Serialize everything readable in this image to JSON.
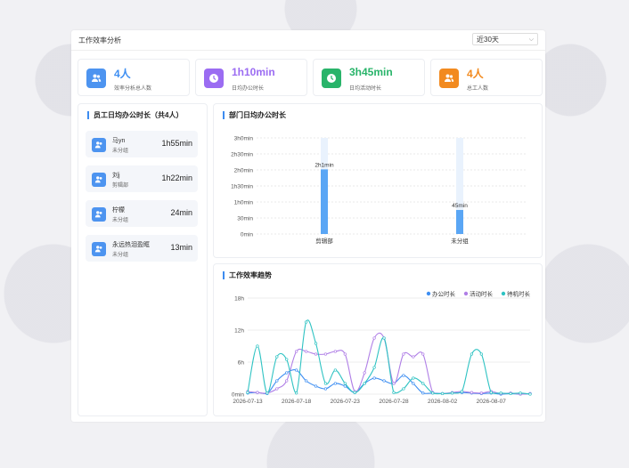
{
  "header": {
    "title": "工作效率分析",
    "range_select": "近30天"
  },
  "stats": [
    {
      "value": "4人",
      "label": "效率分析总人数",
      "color": "#4d94f0",
      "icon": "users-icon"
    },
    {
      "value": "1h10min",
      "label": "日均办公时长",
      "color": "#9b6cf2",
      "icon": "clock-icon"
    },
    {
      "value": "3h45min",
      "label": "日均活动时长",
      "color": "#29b46a",
      "icon": "clock-icon"
    },
    {
      "value": "4人",
      "label": "总工人数",
      "color": "#f28a1f",
      "icon": "users-icon"
    }
  ],
  "employees": {
    "title": "员工日均办公时长（共4人）",
    "items": [
      {
        "name": "马yn",
        "dept": "未分组",
        "time": "1h55min"
      },
      {
        "name": "刘j",
        "dept": "剪辑部",
        "time": "1h22min"
      },
      {
        "name": "柠檬",
        "dept": "未分组",
        "time": "24min"
      },
      {
        "name": "永远热泪盈眶",
        "dept": "未分组",
        "time": "13min"
      }
    ]
  },
  "chart_data": [
    {
      "type": "bar",
      "title": "部门日均办公时长",
      "categories": [
        "剪辑部",
        "未分组"
      ],
      "values": [
        121,
        45
      ],
      "value_labels": [
        "2h1min",
        "45min"
      ],
      "yticks": [
        "0min",
        "30min",
        "1h0min",
        "1h30min",
        "2h0min",
        "2h30min",
        "3h0min"
      ],
      "ylim": [
        0,
        180
      ],
      "grid": true,
      "bar_color": "#5aa6f5",
      "bg_bar_color": "#e9f2fd"
    },
    {
      "type": "line",
      "title": "工作效率趋势",
      "x": [
        "2026-07-13",
        "2026-07-14",
        "2026-07-15",
        "2026-07-16",
        "2026-07-17",
        "2026-07-18",
        "2026-07-19",
        "2026-07-20",
        "2026-07-21",
        "2026-07-22",
        "2026-07-23",
        "2026-07-24",
        "2026-07-25",
        "2026-07-26",
        "2026-07-27",
        "2026-07-28",
        "2026-07-29",
        "2026-07-30",
        "2026-07-31",
        "2026-08-01",
        "2026-08-02",
        "2026-08-03",
        "2026-08-04",
        "2026-08-05",
        "2026-08-06",
        "2026-08-07",
        "2026-08-08",
        "2026-08-09",
        "2026-08-10",
        "2026-08-11"
      ],
      "xticks": [
        "2026-07-13",
        "2026-07-18",
        "2026-07-23",
        "2026-07-28",
        "2026-08-02",
        "2026-08-07"
      ],
      "yticks": [
        "0min",
        "6h",
        "12h",
        "18h"
      ],
      "ylim": [
        0,
        18
      ],
      "legend_position": "top-right",
      "series": [
        {
          "name": "办公时长",
          "color": "#3f8ff2",
          "values": [
            0.2,
            0.3,
            0.1,
            2.5,
            4.0,
            4.5,
            2.5,
            1.5,
            1.0,
            2.0,
            1.5,
            0.3,
            2.0,
            3.0,
            2.5,
            2.0,
            3.5,
            2.0,
            0.2,
            0.2,
            0.1,
            0.2,
            0.3,
            0.2,
            0.1,
            0.2,
            0.0,
            0.1,
            0.0,
            0.1
          ]
        },
        {
          "name": "活动时长",
          "color": "#b07fe6",
          "values": [
            0.5,
            0.3,
            0.2,
            1.0,
            2.5,
            8.0,
            8.0,
            7.5,
            7.5,
            8.0,
            7.5,
            0.5,
            4.0,
            10.5,
            10.5,
            2.0,
            7.5,
            7.0,
            7.5,
            0.3,
            0.1,
            0.3,
            0.5,
            0.3,
            0.2,
            0.5,
            0.1,
            0.2,
            0.0,
            0.1
          ]
        },
        {
          "name": "待机时长",
          "color": "#2fc3c3",
          "values": [
            0.3,
            9.0,
            0.2,
            7.0,
            6.5,
            0.2,
            13.5,
            9.5,
            2.0,
            4.5,
            2.0,
            0.3,
            2.0,
            5.0,
            10.5,
            0.3,
            1.0,
            3.0,
            2.0,
            0.2,
            0.1,
            0.2,
            0.5,
            7.5,
            7.5,
            0.3,
            0.2,
            0.1,
            0.2,
            0.0
          ]
        }
      ]
    }
  ]
}
